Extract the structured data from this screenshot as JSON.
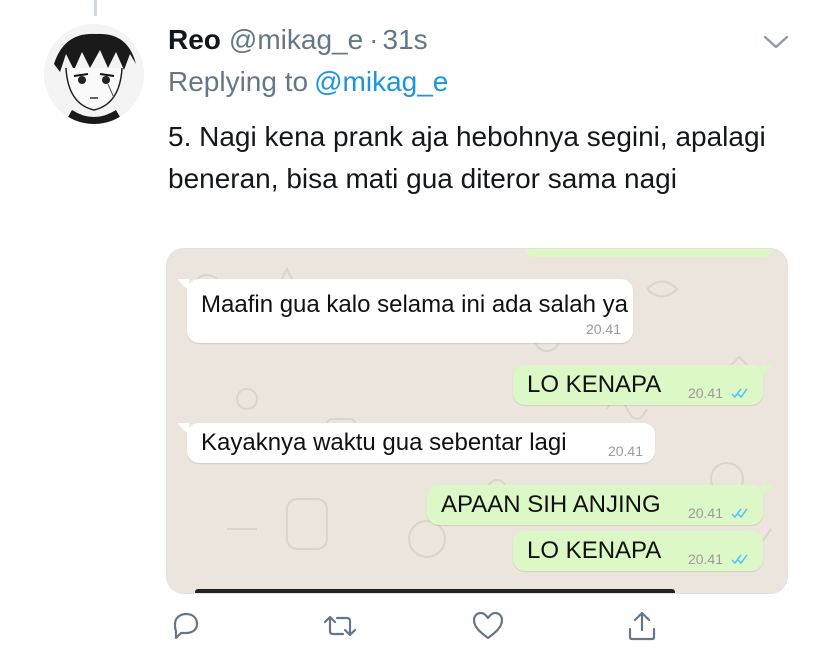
{
  "tweet": {
    "display_name": "Reo",
    "handle": "@mikag_e",
    "separator": "·",
    "timestamp": "31s",
    "replying_prefix": "Replying to",
    "replying_to": "@mikag_e",
    "text": "5. Nagi kena prank aja hebohnya segini, apalagi beneran, bisa mati gua diteror sama nagi"
  },
  "chat": {
    "messages": [
      {
        "direction": "in",
        "text": "Maafin gua kalo selama ini ada salah ya",
        "time": "20.41"
      },
      {
        "direction": "out",
        "text": "LO KENAPA",
        "time": "20.41",
        "status": "read-ticks-icon"
      },
      {
        "direction": "in",
        "text": "Kayaknya waktu gua sebentar lagi",
        "time": "20.41"
      },
      {
        "direction": "out",
        "text": "APAAN SIH ANJING",
        "time": "20.41",
        "status": "read-ticks-icon"
      },
      {
        "direction": "out",
        "text": "LO KENAPA",
        "time": "20.41",
        "status": "read-ticks-icon"
      }
    ]
  },
  "actions": [
    {
      "name": "reply-icon"
    },
    {
      "name": "retweet-icon"
    },
    {
      "name": "like-icon"
    },
    {
      "name": "share-icon"
    }
  ],
  "colors": {
    "link": "#1b95e0",
    "secondary_text": "#657786",
    "incoming_bubble": "#ffffff",
    "outgoing_bubble": "#dcf8c6",
    "chat_background": "#ece5dd",
    "read_ticks": "#4fc3f7"
  }
}
